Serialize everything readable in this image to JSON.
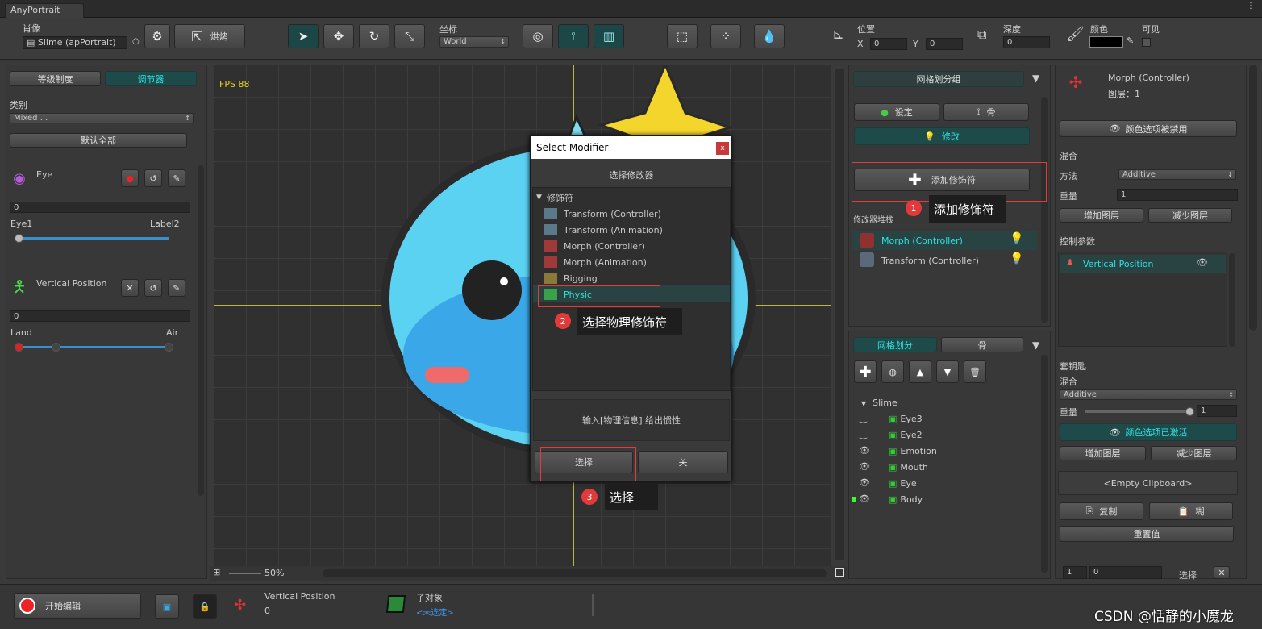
{
  "window": {
    "title": "AnyPortrait"
  },
  "toolbar": {
    "portrait_label": "肖像",
    "portrait_value": "Slime (apPortrait)",
    "bake_label": "烘烤",
    "coord_label": "坐标",
    "coord_value": "World",
    "pos_label": "位置",
    "x_label": "X",
    "x_value": "0",
    "y_label": "Y",
    "y_value": "0",
    "depth_label": "深度",
    "depth_value": "0",
    "color_label": "颜色",
    "visible_label": "可见"
  },
  "left": {
    "tab_hierarchy": "等级制度",
    "tab_controller": "调节器",
    "category_label": "类别",
    "category_value": "Mixed ...",
    "default_all": "默认全部",
    "eye_label": "Eye",
    "eye_value": "0",
    "eye_min": "Eye1",
    "eye_max": "Label2",
    "vp_label": "Vertical Position",
    "vp_value": "0",
    "vp_min": "Land",
    "vp_max": "Air"
  },
  "viewport": {
    "fps": "FPS 88",
    "zoom": "50%"
  },
  "dialog": {
    "title": "Select Modifier",
    "close": "x",
    "subtitle": "选择修改器",
    "group": "修饰符",
    "items": [
      "Transform (Controller)",
      "Transform (Animation)",
      "Morph (Controller)",
      "Morph (Animation)",
      "Rigging",
      "Physic"
    ],
    "description": "输入[物理信息] 给出惯性",
    "select_btn": "选择",
    "close_btn": "关"
  },
  "annotations": {
    "n1": "1",
    "t1": "添加修饰符",
    "n2": "2",
    "t2": "选择物理修饰符",
    "n3": "3",
    "t3": "选择"
  },
  "mesh": {
    "group_title": "网格划分组",
    "settings": "设定",
    "bone": "骨",
    "modify": "修改",
    "add_modifier": "添加修饰符",
    "stack_label": "修改器堆栈",
    "stack": [
      "Morph (Controller)",
      "Transform (Controller)"
    ],
    "tab_mesh": "网格划分",
    "tab_bone": "骨",
    "root": "Slime",
    "children": [
      "Eye3",
      "Eye2",
      "Emotion",
      "Mouth",
      "Eye",
      "Body"
    ]
  },
  "right": {
    "title": "Morph (Controller)",
    "layer": "图层：1",
    "color_disabled": "颜色选项被禁用",
    "blend": "混合",
    "method_label": "方法",
    "method_value": "Additive",
    "weight_label": "重量",
    "weight_value": "1",
    "add_layer": "增加图层",
    "remove_layer": "减少图层",
    "ctrl_params": "控制参数",
    "param": "Vertical Position",
    "keys": "套钥匙",
    "blend2": "混合",
    "blend2_value": "Additive",
    "weight2_label": "重量",
    "weight2_value": "1",
    "color_enabled": "颜色选项已激活",
    "add_layer2": "增加图层",
    "remove_layer2": "减少图层",
    "clipboard": "<Empty Clipboard>",
    "copy": "复制",
    "paste": "糊",
    "reset": "重置值",
    "f1": "1",
    "f2": "0",
    "select": "选择"
  },
  "bottom": {
    "start_edit": "开始编辑",
    "param_name": "Vertical Position",
    "param_value": "0",
    "child_label": "子对象",
    "child_value": "<未选定>"
  },
  "watermark": "CSDN @恬静的小魔龙"
}
